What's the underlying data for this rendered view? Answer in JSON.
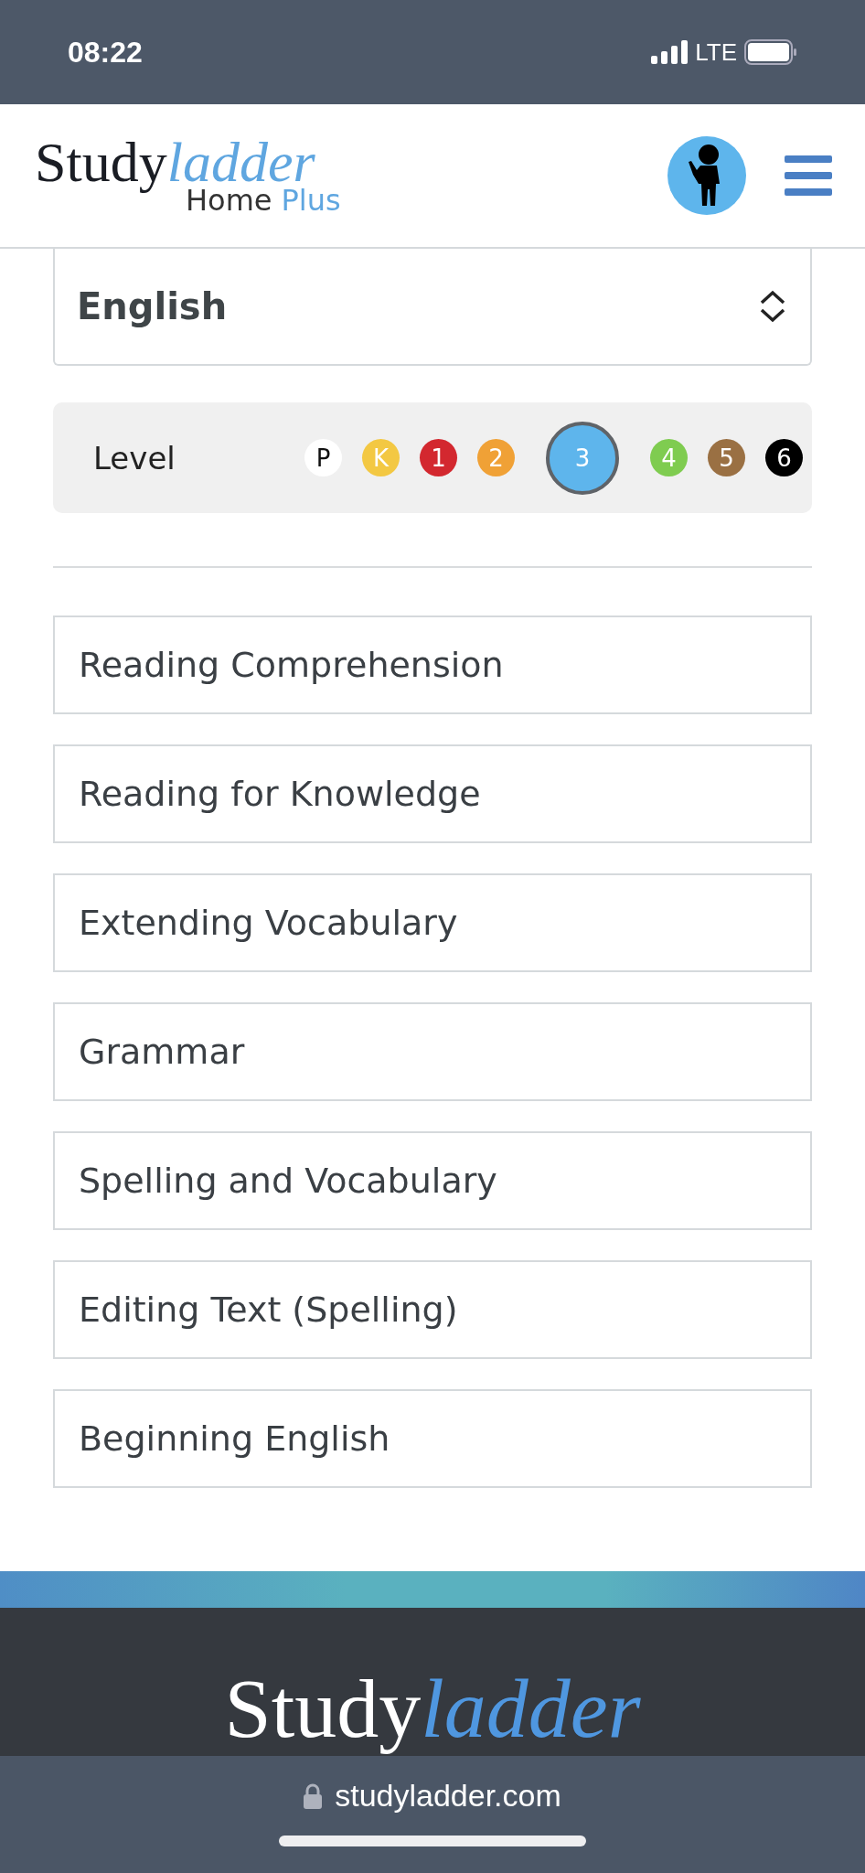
{
  "status_bar": {
    "time": "08:22",
    "network": "LTE"
  },
  "header": {
    "logo": {
      "primary": "Study",
      "accent": "ladder",
      "sub": "Home",
      "sub_accent": "Plus"
    }
  },
  "subject_select": {
    "value": "English"
  },
  "level_picker": {
    "label": "Level",
    "levels": [
      {
        "label": "P",
        "color": "#ffffff",
        "selected": false
      },
      {
        "label": "K",
        "color": "#f3c843",
        "selected": false
      },
      {
        "label": "1",
        "color": "#d3282f",
        "selected": false
      },
      {
        "label": "2",
        "color": "#f0a136",
        "selected": false
      },
      {
        "label": "3",
        "color": "#5eb5ec",
        "selected": true
      },
      {
        "label": "4",
        "color": "#7fcc50",
        "selected": false
      },
      {
        "label": "5",
        "color": "#9a7043",
        "selected": false
      },
      {
        "label": "6",
        "color": "#000000",
        "selected": false
      }
    ]
  },
  "topics": [
    "Reading Comprehension",
    "Reading for Knowledge",
    "Extending Vocabulary",
    "Grammar",
    "Spelling and Vocabulary",
    "Editing Text (Spelling)",
    "Beginning English"
  ],
  "footer": {
    "logo": {
      "primary": "Study",
      "accent": "ladder"
    }
  },
  "browser_bar": {
    "url": "studyladder.com"
  }
}
